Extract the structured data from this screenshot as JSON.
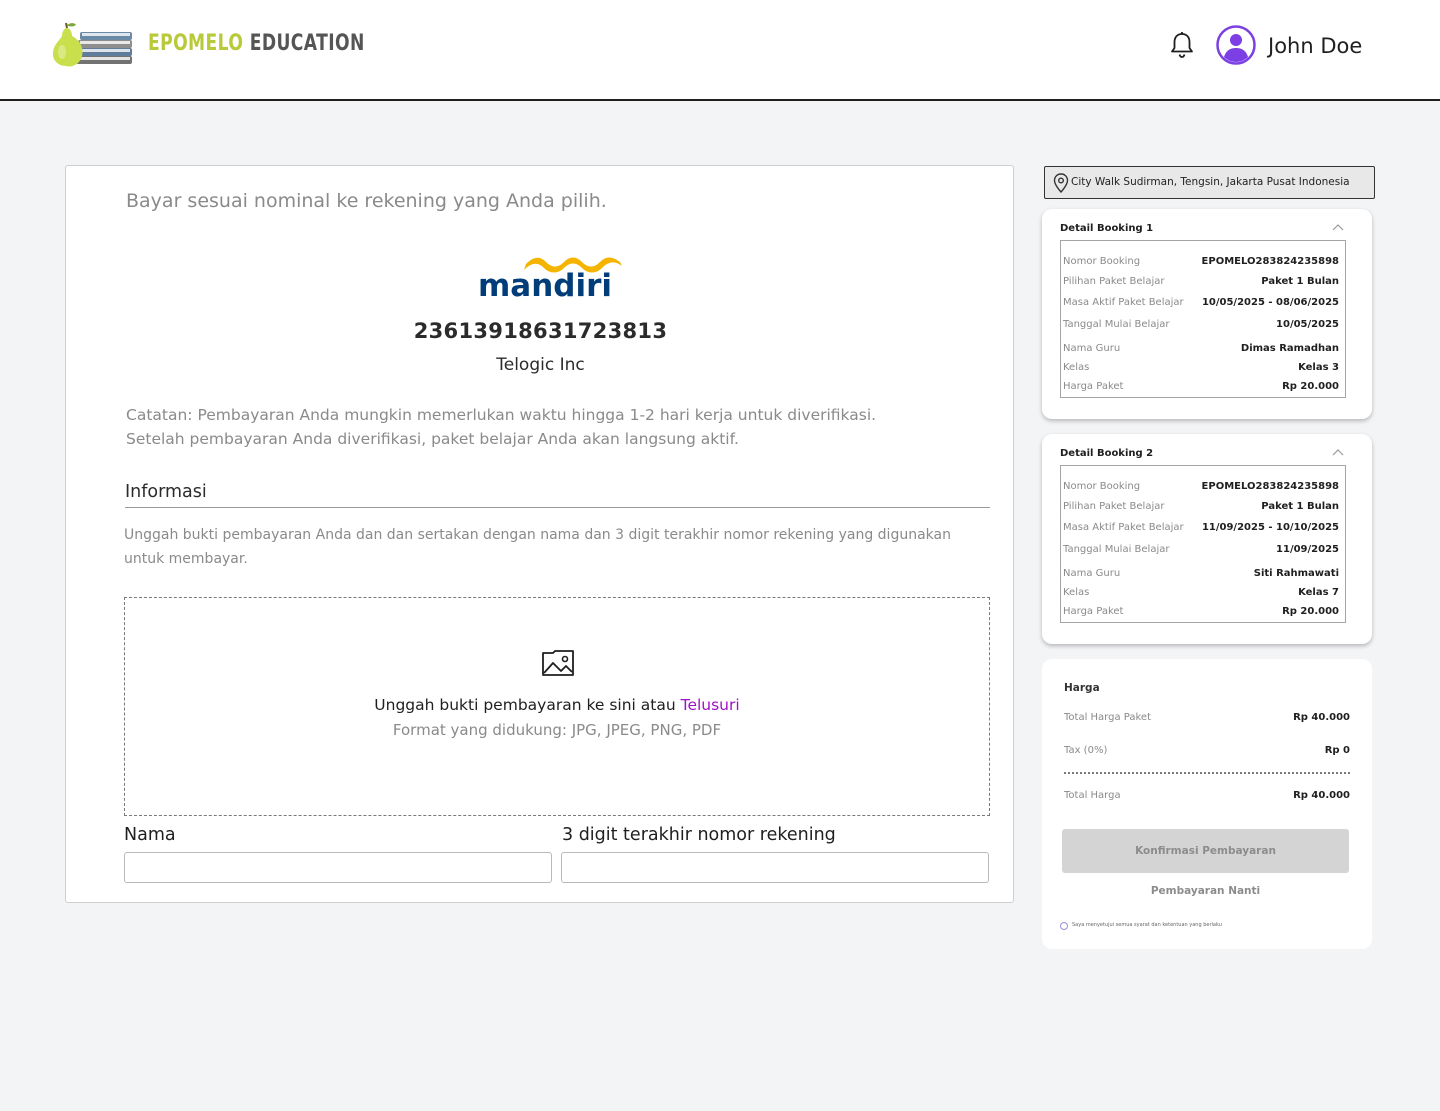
{
  "header": {
    "logo_text_1": "EPOMELO",
    "logo_text_2": "EDUCATION",
    "user_name": "John Doe",
    "icons": {
      "notification": "bell-icon",
      "avatar": "user-avatar-icon"
    }
  },
  "payment": {
    "instruction": "Bayar sesuai nominal ke rekening yang Anda pilih.",
    "bank_logo_text": "mandiri",
    "account_number": "23613918631723813",
    "account_name": "Telogic Inc",
    "note_line_1": "Catatan: Pembayaran Anda mungkin memerlukan waktu hingga 1-2 hari kerja untuk diverifikasi.",
    "note_line_2": "Setelah pembayaran Anda diverifikasi, paket belajar Anda akan langsung aktif."
  },
  "informasi": {
    "title": "Informasi",
    "description": "Unggah bukti pembayaran Anda dan dan sertakan dengan nama dan 3 digit terakhir nomor rekening yang digunakan untuk membayar."
  },
  "upload": {
    "text": "Unggah bukti pembayaran ke sini atau",
    "browse_link": "Telusuri",
    "formats": "Format yang didukung: JPG, JPEG, PNG, PDF",
    "icon": "image-icon"
  },
  "form": {
    "name_label": "Nama",
    "name_value": "",
    "digits_label": "3 digit terakhir nomor rekening",
    "digits_value": ""
  },
  "location": {
    "text": "City Walk Sudirman, Tengsin, Jakarta Pusat Indonesia",
    "icon": "map-pin-icon"
  },
  "bookings": [
    {
      "title": "Detail Booking 1",
      "rows": [
        {
          "label": "Nomor Booking",
          "value": "EPOMELO283824235898"
        },
        {
          "label": "Pilihan Paket Belajar",
          "value": "Paket 1 Bulan"
        },
        {
          "label": "Masa Aktif Paket Belajar",
          "value": "10/05/2025 - 08/06/2025"
        },
        {
          "label": "Tanggal Mulai Belajar",
          "value": "10/05/2025"
        },
        {
          "label": "Nama Guru",
          "value": "Dimas Ramadhan"
        },
        {
          "label": "Kelas",
          "value": "Kelas 3"
        },
        {
          "label": "Harga Paket",
          "value": "Rp 20.000"
        }
      ]
    },
    {
      "title": "Detail Booking 2",
      "rows": [
        {
          "label": "Nomor Booking",
          "value": "EPOMELO283824235898"
        },
        {
          "label": "Pilihan Paket Belajar",
          "value": "Paket 1 Bulan"
        },
        {
          "label": "Masa Aktif Paket Belajar",
          "value": "11/09/2025 - 10/10/2025"
        },
        {
          "label": "Tanggal Mulai Belajar",
          "value": "11/09/2025"
        },
        {
          "label": "Nama Guru",
          "value": "Siti Rahmawati"
        },
        {
          "label": "Kelas",
          "value": "Kelas 7"
        },
        {
          "label": "Harga Paket",
          "value": "Rp 20.000"
        }
      ]
    }
  ],
  "price": {
    "title": "Harga",
    "total_package_label": "Total Harga Paket",
    "total_package_value": "Rp 40.000",
    "tax_label": "Tax (0%)",
    "tax_value": "Rp 0",
    "total_label": "Total Harga",
    "total_value": "Rp 40.000",
    "confirm_button": "Konfirmasi Pembayaran",
    "later_button": "Pembayaran Nanti",
    "agreement": "Saya menyetujui semua syarat dan ketentuan yang berlaku"
  },
  "colors": {
    "accent_link": "#a010c8",
    "logo_green": "#b8c93a",
    "avatar_purple": "#7b3fe4",
    "mandiri_blue": "#003d79",
    "mandiri_gold": "#f4b400"
  }
}
